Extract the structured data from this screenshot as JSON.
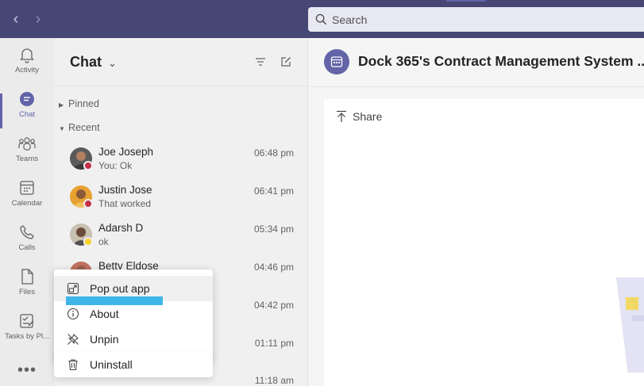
{
  "topbar": {
    "search_placeholder": "Search"
  },
  "rail": {
    "items": [
      {
        "label": "Activity",
        "icon": "bell-icon"
      },
      {
        "label": "Chat",
        "icon": "chat-icon",
        "active": true
      },
      {
        "label": "Teams",
        "icon": "teams-icon"
      },
      {
        "label": "Calendar",
        "icon": "calendar-icon"
      },
      {
        "label": "Calls",
        "icon": "phone-icon"
      },
      {
        "label": "Files",
        "icon": "file-icon"
      },
      {
        "label": "Tasks by Pl...",
        "icon": "tasks-icon"
      }
    ],
    "more": "•••"
  },
  "chatlist": {
    "title": "Chat",
    "sections": {
      "pinned": "Pinned",
      "recent": "Recent"
    },
    "chats": [
      {
        "name": "Joe Joseph",
        "preview": "You: Ok",
        "time": "06:48 pm",
        "status": "busy"
      },
      {
        "name": "Justin Jose",
        "preview": "That worked",
        "time": "06:41 pm",
        "status": "busy"
      },
      {
        "name": "Adarsh D",
        "preview": "ok",
        "time": "05:34 pm",
        "status": "away"
      },
      {
        "name": "Betty Eldose",
        "preview": "",
        "time": "04:46 pm",
        "status": "none"
      },
      {
        "name": "",
        "preview": "",
        "time": "04:42 pm",
        "status": "none"
      },
      {
        "name": "",
        "preview": "",
        "time": "01:11 pm",
        "status": "none"
      },
      {
        "name": "",
        "preview": "",
        "time": "11:18 am",
        "status": "none"
      }
    ]
  },
  "context_menu": {
    "items": [
      {
        "label": "Pop out app",
        "icon": "pop-out-icon"
      },
      {
        "label": "About",
        "icon": "info-icon"
      },
      {
        "label": "Unpin",
        "icon": "unpin-icon"
      },
      {
        "label": "Uninstall",
        "icon": "trash-icon"
      }
    ]
  },
  "main": {
    "app_title": "Dock 365's Contract Management System ...",
    "share_label": "Share"
  },
  "colors": {
    "brand": "#464775",
    "accent": "#6264a7",
    "highlight": "#3fb6e8"
  }
}
